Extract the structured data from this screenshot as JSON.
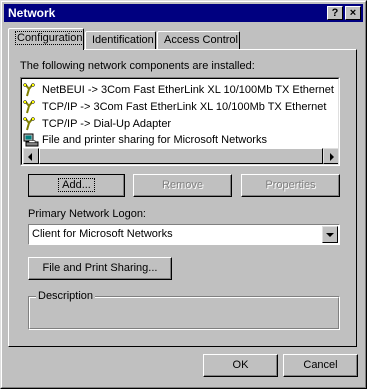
{
  "window": {
    "title": "Network",
    "help_button": "?",
    "close_button": "×"
  },
  "tabs": [
    {
      "label": "Configuration",
      "active": true
    },
    {
      "label": "Identification",
      "active": false
    },
    {
      "label": "Access Control",
      "active": false
    }
  ],
  "components": {
    "label": "The following network components are installed:",
    "items": [
      {
        "icon": "network-protocol-icon",
        "text": "NetBEUI -> 3Com Fast EtherLink XL 10/100Mb TX Ethernet"
      },
      {
        "icon": "network-protocol-icon",
        "text": "TCP/IP -> 3Com Fast EtherLink XL 10/100Mb TX Ethernet"
      },
      {
        "icon": "network-protocol-icon",
        "text": "TCP/IP -> Dial-Up Adapter"
      },
      {
        "icon": "network-service-icon",
        "text": "File and printer sharing for Microsoft Networks"
      }
    ]
  },
  "buttons": {
    "add": "Add...",
    "remove": "Remove",
    "properties": "Properties",
    "file_print_sharing": "File and Print Sharing...",
    "ok": "OK",
    "cancel": "Cancel"
  },
  "logon": {
    "label": "Primary Network Logon:",
    "value": "Client for Microsoft Networks"
  },
  "description": {
    "label": "Description",
    "text": ""
  }
}
